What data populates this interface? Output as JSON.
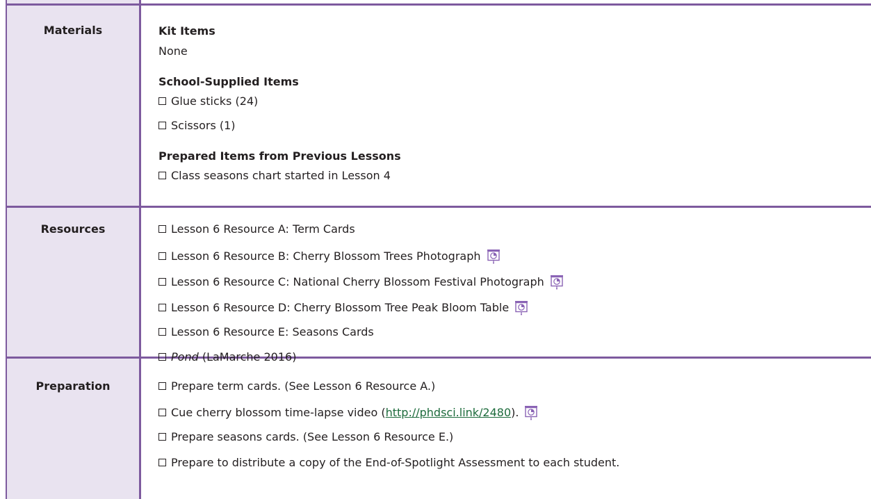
{
  "colors": {
    "label_bg": "#e9e3f0",
    "border": "#7d5a9e",
    "link": "#1d6b3c",
    "icon": "#8a63b5"
  },
  "materials": {
    "label": "Materials",
    "kit_heading": "Kit Items",
    "kit_value": "None",
    "school_heading": "School-Supplied Items",
    "school_items": [
      "Glue sticks (24)",
      "Scissors (1)"
    ],
    "prepared_heading": "Prepared Items from Previous Lessons",
    "prepared_items": [
      "Class seasons chart started in Lesson 4"
    ]
  },
  "resources": {
    "label": "Resources",
    "items": [
      "Lesson 6 Resource A: Term Cards",
      "Lesson 6 Resource B: Cherry Blossom Trees Photograph",
      "Lesson 6 Resource C: National Cherry Blossom Festival Photograph",
      "Lesson 6 Resource D: Cherry Blossom Tree Peak Bloom Table",
      "Lesson 6 Resource E: Seasons Cards"
    ],
    "book_title": "Pond",
    "book_suffix": " (LaMarche 2016)",
    "projection_icon": "projector-screen-icon"
  },
  "preparation": {
    "label": "Preparation",
    "item1": "Prepare term cards. (See Lesson 6 Resource A.)",
    "item2_prefix": "Cue cherry blossom time-lapse video (",
    "item2_link": "http://phdsci.link/2480",
    "item2_suffix": ").",
    "item3": "Prepare seasons cards. (See Lesson 6 Resource E.)",
    "item4": "Prepare to distribute a copy of the End-of-Spotlight Assessment to each student."
  }
}
